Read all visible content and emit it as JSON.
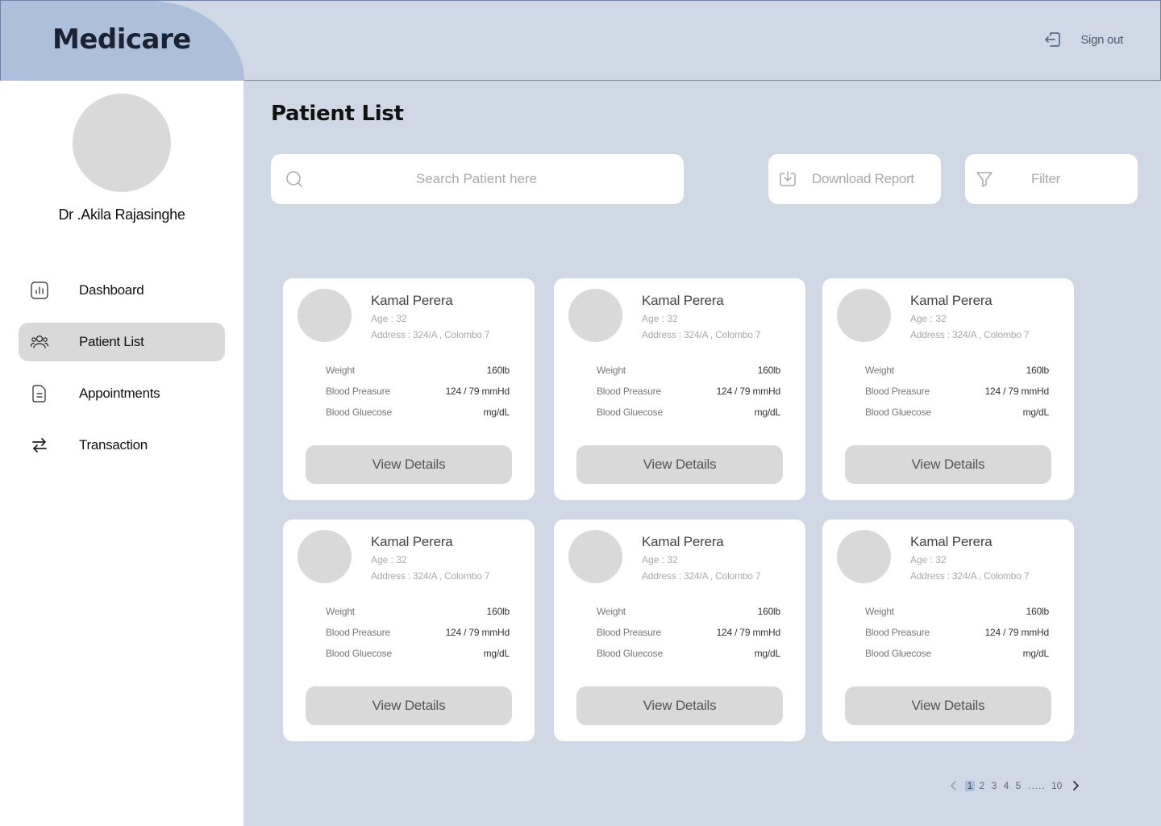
{
  "app": {
    "name": "Medicare"
  },
  "header": {
    "signout_label": "Sign out",
    "signout_icon": "sign-out-icon"
  },
  "sidebar": {
    "doctor_name": "Dr .Akila Rajasinghe",
    "items": [
      {
        "label": "Dashboard",
        "icon": "chart-icon",
        "active": false
      },
      {
        "label": "Patient List",
        "icon": "users-icon",
        "active": true
      },
      {
        "label": "Appointments",
        "icon": "document-icon",
        "active": false
      },
      {
        "label": "Transaction",
        "icon": "transfer-icon",
        "active": false
      }
    ]
  },
  "main": {
    "title": "Patient List",
    "search": {
      "placeholder": "Search Patient here"
    },
    "download_label": "Download Report",
    "filter_label": "Filter"
  },
  "patients": [
    {
      "name": "Kamal Perera",
      "age": "Age : 32",
      "address": "Address : 324/A , Colombo 7",
      "vitals": [
        {
          "label": "Weight",
          "value": "160lb"
        },
        {
          "label": "Blood Preasure",
          "value": "124 / 79 mmHd"
        },
        {
          "label": "Blood Gluecose",
          "value": "mg/dL"
        }
      ],
      "button": "View Details"
    },
    {
      "name": "Kamal Perera",
      "age": "Age : 32",
      "address": "Address : 324/A , Colombo 7",
      "vitals": [
        {
          "label": "Weight",
          "value": "160lb"
        },
        {
          "label": "Blood Preasure",
          "value": "124 / 79 mmHd"
        },
        {
          "label": "Blood Gluecose",
          "value": "mg/dL"
        }
      ],
      "button": "View Details"
    },
    {
      "name": "Kamal Perera",
      "age": "Age : 32",
      "address": "Address : 324/A , Colombo 7",
      "vitals": [
        {
          "label": "Weight",
          "value": "160lb"
        },
        {
          "label": "Blood Preasure",
          "value": "124 / 79 mmHd"
        },
        {
          "label": "Blood Gluecose",
          "value": "mg/dL"
        }
      ],
      "button": "View Details"
    },
    {
      "name": "Kamal Perera",
      "age": "Age : 32",
      "address": "Address : 324/A , Colombo 7",
      "vitals": [
        {
          "label": "Weight",
          "value": "160lb"
        },
        {
          "label": "Blood Preasure",
          "value": "124 / 79 mmHd"
        },
        {
          "label": "Blood Gluecose",
          "value": "mg/dL"
        }
      ],
      "button": "View Details"
    },
    {
      "name": "Kamal Perera",
      "age": "Age : 32",
      "address": "Address : 324/A , Colombo 7",
      "vitals": [
        {
          "label": "Weight",
          "value": "160lb"
        },
        {
          "label": "Blood Preasure",
          "value": "124 / 79 mmHd"
        },
        {
          "label": "Blood Gluecose",
          "value": "mg/dL"
        }
      ],
      "button": "View Details"
    },
    {
      "name": "Kamal Perera",
      "age": "Age : 32",
      "address": "Address : 324/A , Colombo 7",
      "vitals": [
        {
          "label": "Weight",
          "value": "160lb"
        },
        {
          "label": "Blood Preasure",
          "value": "124 / 79 mmHd"
        },
        {
          "label": "Blood Gluecose",
          "value": "mg/dL"
        }
      ],
      "button": "View Details"
    }
  ],
  "pagination": {
    "pages": [
      "1",
      "2",
      "3",
      "4",
      "5"
    ],
    "ellipsis": ".....",
    "last": "10",
    "current": "1"
  },
  "colors": {
    "background": "#cfd8e4",
    "logo_bg": "#aebfdc",
    "card": "#ffffff",
    "button": "#d9d9d9",
    "active_nav": "#d9d9d9"
  }
}
